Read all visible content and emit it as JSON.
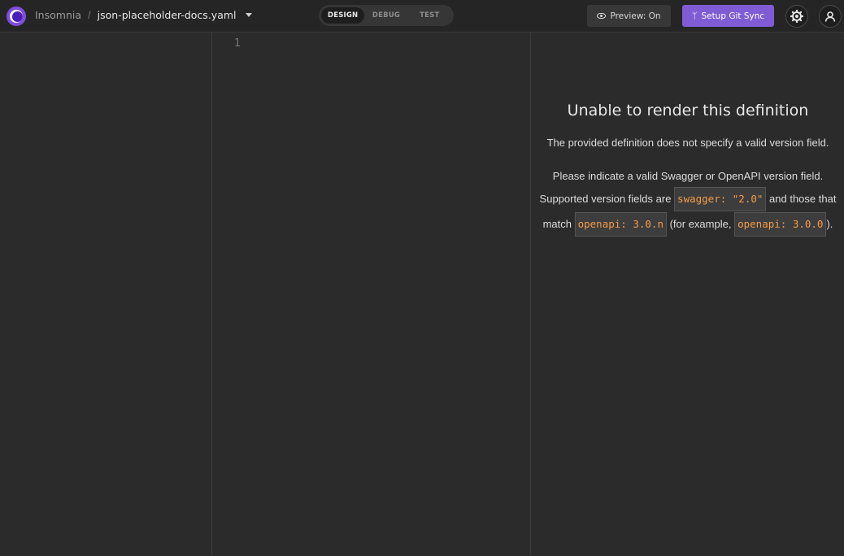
{
  "header": {
    "app_name": "Insomnia",
    "separator": "/",
    "document_name": "json-placeholder-docs.yaml",
    "tabs": [
      {
        "label": "DESIGN",
        "active": true
      },
      {
        "label": "DEBUG",
        "active": false
      },
      {
        "label": "TEST",
        "active": false
      }
    ],
    "preview_label": "Preview: On",
    "git_sync_label": "Setup Git Sync"
  },
  "editor": {
    "line_numbers": [
      "1"
    ]
  },
  "preview": {
    "title": "Unable to render this definition",
    "line1": "The provided definition does not specify a valid version field.",
    "line2": "Please indicate a valid Swagger or OpenAPI version field.",
    "supported_prefix": "Supported version fields are",
    "code_swagger": "swagger: \"2.0\"",
    "and_those": "and those that match",
    "code_openapi_n": "openapi: 3.0.n",
    "for_example": "(for example,",
    "code_openapi_example": "openapi: 3.0.0",
    "closing": ")."
  },
  "colors": {
    "accent": "#7f5bd6",
    "code_text": "#f39c4a",
    "background": "#2b2b2b"
  }
}
